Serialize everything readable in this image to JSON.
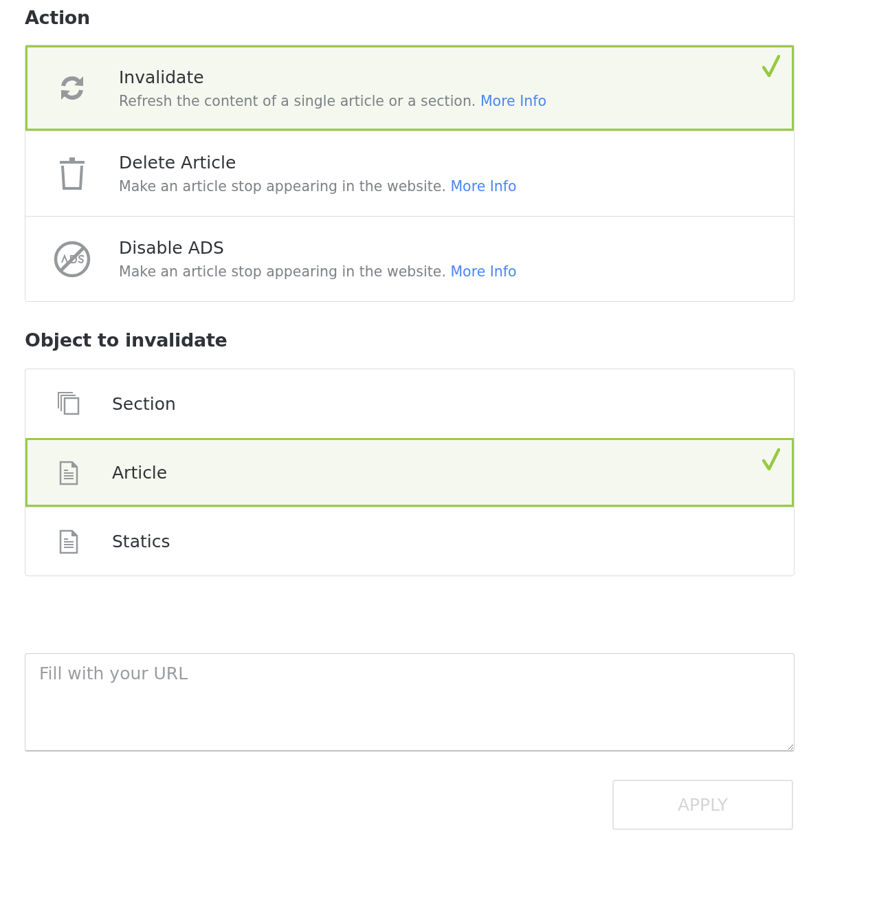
{
  "action": {
    "heading": "Action",
    "options": [
      {
        "kind": "refresh",
        "title": "Invalidate",
        "description": "Refresh the content of a single article or a section.",
        "link": "More Info",
        "selected": true
      },
      {
        "kind": "trash",
        "title": "Delete Article",
        "description": "Make an article stop appearing in the website.",
        "link": "More Info",
        "selected": false
      },
      {
        "kind": "no-ads",
        "title": "Disable ADS",
        "description": "Make an article stop appearing in the website.",
        "link": "More Info",
        "selected": false
      }
    ]
  },
  "object": {
    "heading": "Object to invalidate",
    "options": [
      {
        "kind": "copies",
        "title": "Section",
        "selected": false
      },
      {
        "kind": "document",
        "title": "Article",
        "selected": true
      },
      {
        "kind": "document",
        "title": "Statics",
        "selected": false
      }
    ]
  },
  "url_field": {
    "placeholder": "Fill with your URL"
  },
  "apply_button": {
    "label": "APPLY",
    "disabled": true
  }
}
